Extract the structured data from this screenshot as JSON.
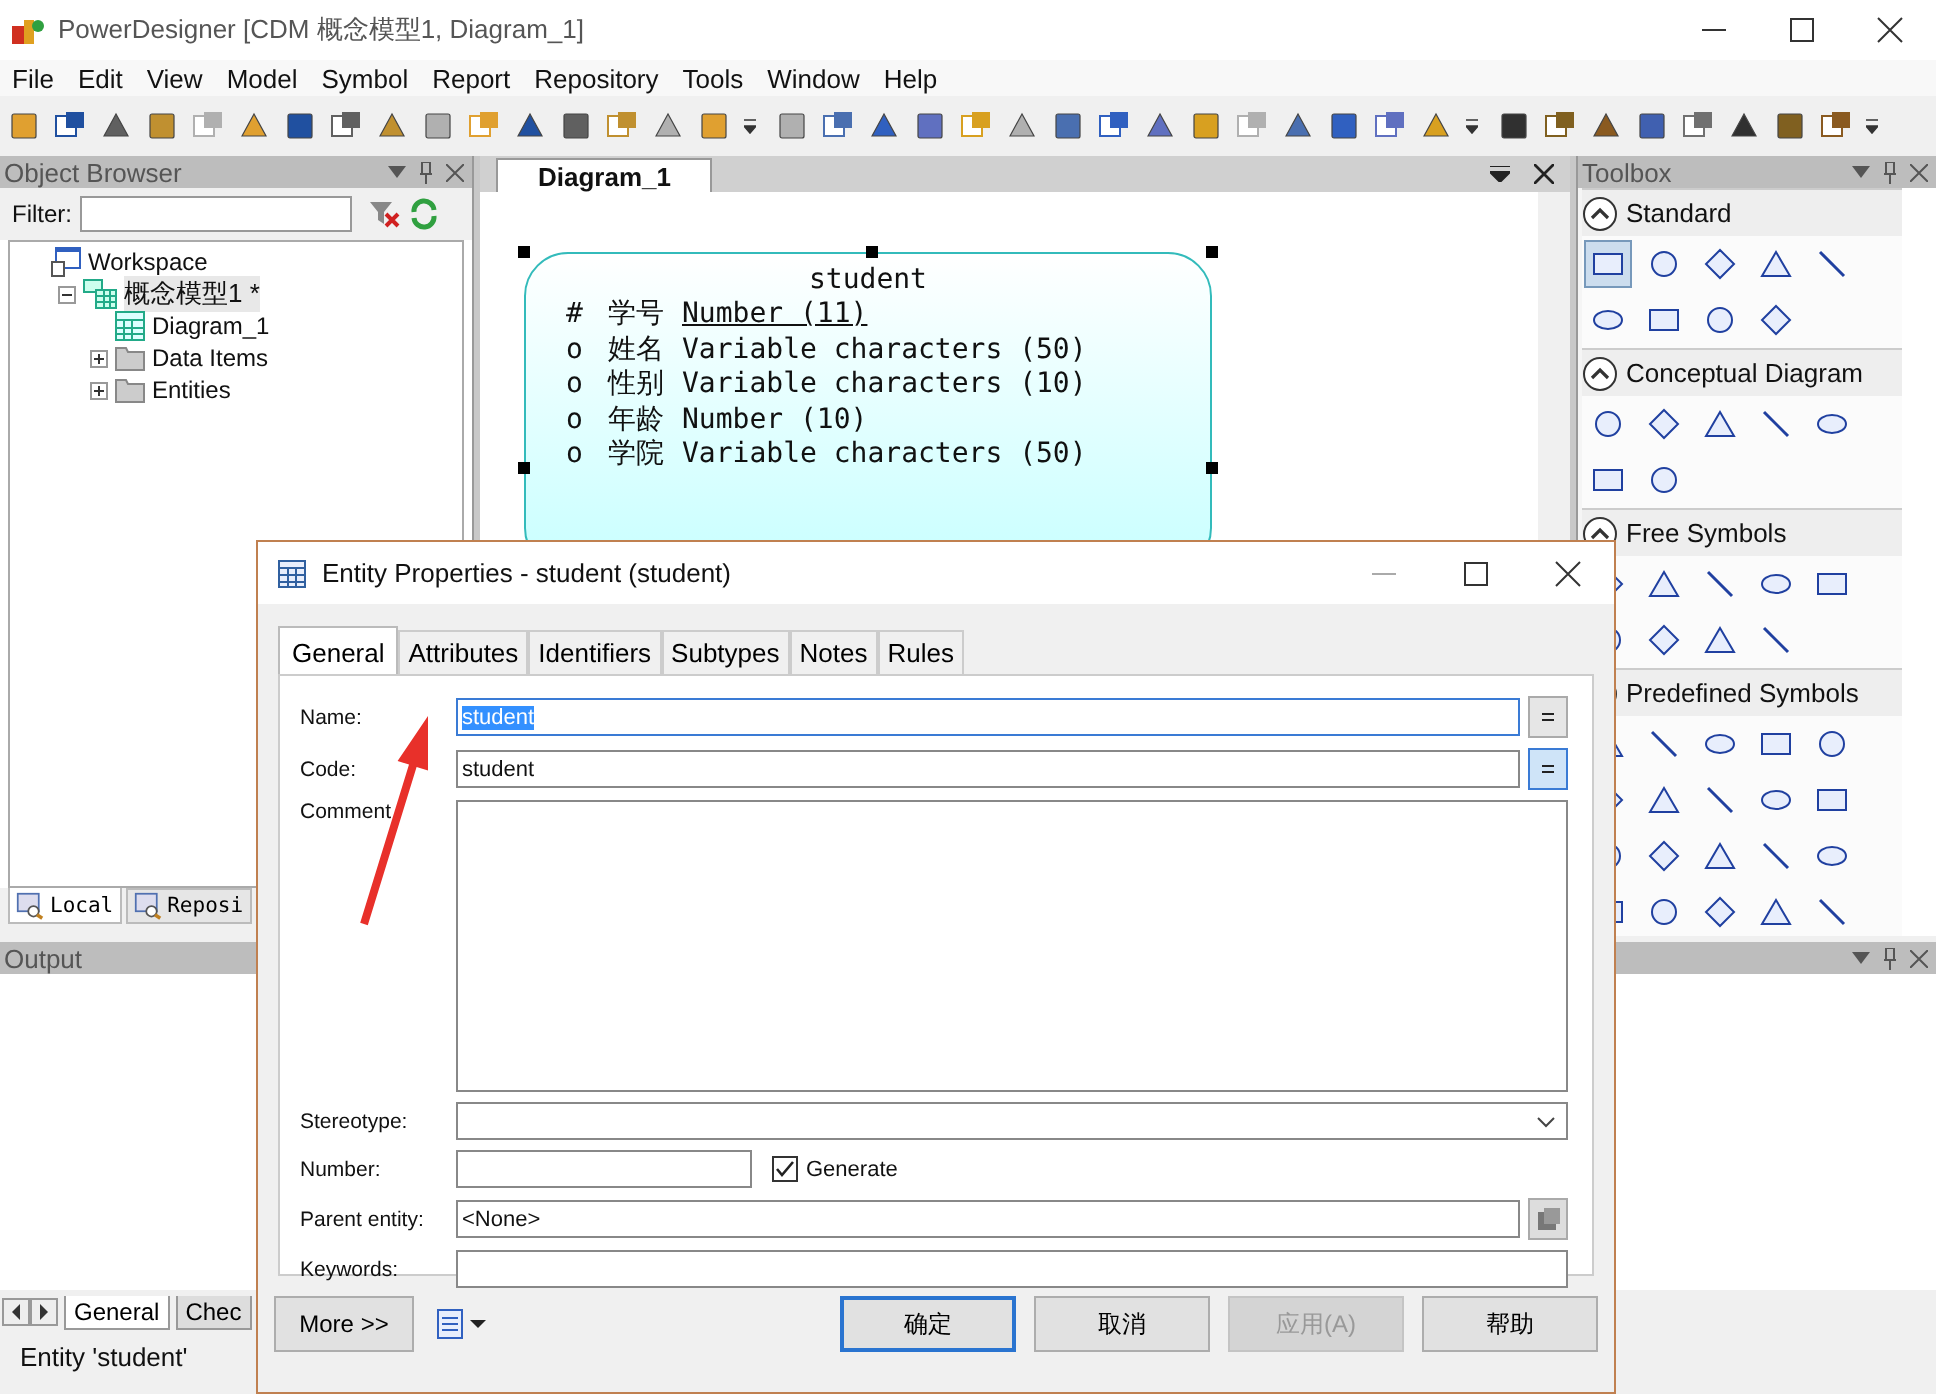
{
  "window": {
    "title": "PowerDesigner [CDM 概念模型1, Diagram_1]"
  },
  "menu": [
    "File",
    "Edit",
    "View",
    "Model",
    "Symbol",
    "Report",
    "Repository",
    "Tools",
    "Window",
    "Help"
  ],
  "object_browser": {
    "title": "Object Browser",
    "filter_label": "Filter:",
    "tree": [
      {
        "label": "Workspace",
        "kind": "workspace",
        "selected": false,
        "children": [
          {
            "label": "概念模型1 *",
            "kind": "model",
            "selected": true,
            "expanded": true,
            "children": [
              {
                "label": "Diagram_1",
                "kind": "diagram",
                "selected": false
              },
              {
                "label": "Data Items",
                "kind": "folder",
                "selected": false,
                "expanded": false
              },
              {
                "label": "Entities",
                "kind": "folder",
                "selected": false,
                "expanded": false
              }
            ]
          }
        ]
      }
    ],
    "tabs": [
      {
        "label": "Local",
        "selected": true
      },
      {
        "label": "Reposi",
        "selected": false
      }
    ]
  },
  "diagram": {
    "tab": "Diagram_1",
    "entity": {
      "name": "student",
      "selected": true,
      "attributes": [
        {
          "marker": "#",
          "name": "学号",
          "type": "Number (11)",
          "identifier": true
        },
        {
          "marker": "o",
          "name": "姓名",
          "type": "Variable characters (50)",
          "identifier": false
        },
        {
          "marker": "o",
          "name": "性别",
          "type": "Variable characters (10)",
          "identifier": false
        },
        {
          "marker": "o",
          "name": "年龄",
          "type": "Number (10)",
          "identifier": false
        },
        {
          "marker": "o",
          "name": "学院",
          "type": "Variable characters (50)",
          "identifier": false
        }
      ]
    }
  },
  "toolbox": {
    "title": "Toolbox",
    "sections": [
      {
        "title": "Standard",
        "expanded": true
      },
      {
        "title": "Conceptual Diagram",
        "expanded": true
      },
      {
        "title": "Free Symbols",
        "expanded": true
      },
      {
        "title": "Predefined Symbols",
        "expanded": true
      }
    ]
  },
  "output": {
    "title": "Output",
    "tabs": [
      {
        "label": "General",
        "selected": true
      },
      {
        "label": "Chec",
        "selected": false
      }
    ]
  },
  "status_bar": "Entity 'student'",
  "dialog": {
    "title": "Entity Properties - student (student)",
    "tabs": [
      {
        "label": "General",
        "selected": true
      },
      {
        "label": "Attributes",
        "selected": false
      },
      {
        "label": "Identifiers",
        "selected": false
      },
      {
        "label": "Subtypes",
        "selected": false
      },
      {
        "label": "Notes",
        "selected": false
      },
      {
        "label": "Rules",
        "selected": false
      }
    ],
    "name": {
      "label": "Name:",
      "value": "student",
      "highlighted": true,
      "sync_on": false
    },
    "code": {
      "label": "Code:",
      "value": "student",
      "highlighted": false,
      "sync_on": true
    },
    "comment": {
      "label": "Comment"
    },
    "stereotype": {
      "label": "Stereotype:"
    },
    "number": {
      "label": "Number:",
      "generate_label": "Generate",
      "generate_checked": true
    },
    "parent": {
      "label": "Parent entity:",
      "value": "<None>"
    },
    "keywords": {
      "label": "Keywords:"
    },
    "more": "More >>",
    "buttons": [
      {
        "label": "确定",
        "default": true,
        "disabled": false
      },
      {
        "label": "取消",
        "default": false,
        "disabled": false
      },
      {
        "label": "应用(A)",
        "default": false,
        "disabled": true
      },
      {
        "label": "帮助",
        "default": false,
        "disabled": false
      }
    ]
  }
}
